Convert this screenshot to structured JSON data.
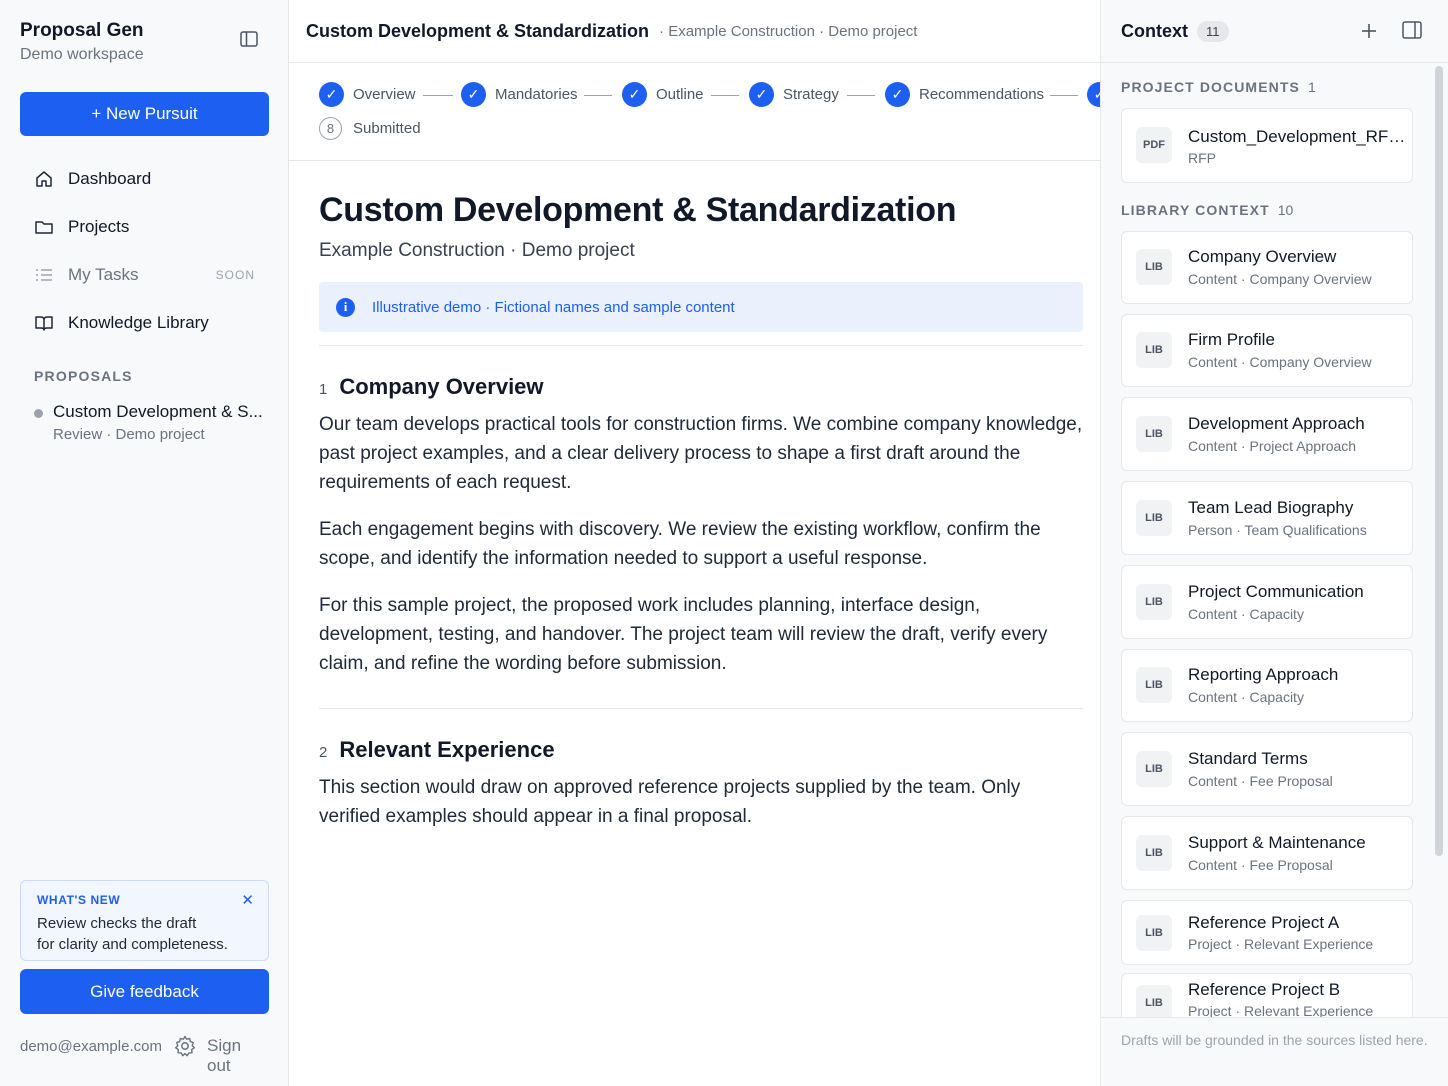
{
  "sidebar": {
    "brand_title": "Proposal Gen",
    "brand_sub": "Demo workspace",
    "new_button": "+ New Pursuit",
    "nav": [
      {
        "label": "Dashboard",
        "icon": "home-icon"
      },
      {
        "label": "Projects",
        "icon": "folder-icon"
      },
      {
        "label": "My Tasks",
        "icon": "list-icon",
        "tag": "SOON"
      },
      {
        "label": "Knowledge Library",
        "icon": "book-icon"
      }
    ],
    "proposals_label": "PROPOSALS",
    "proposal": {
      "title": "Custom Development & S...",
      "sub": "Review · Demo project"
    },
    "whats_new": {
      "label": "WHAT'S NEW",
      "line1": "Review checks the draft",
      "line2": "for clarity and completeness.",
      "close": "✕"
    },
    "feedback_button": "Give feedback",
    "email": "demo@example.com",
    "sign_out": "Sign out"
  },
  "topbar": {
    "title": "Custom Development & Standardization",
    "meta": "· Example Construction · Demo project"
  },
  "stepper": {
    "steps": [
      {
        "label": "Overview",
        "state": "done"
      },
      {
        "label": "Mandatories",
        "state": "done"
      },
      {
        "label": "Outline",
        "state": "done"
      },
      {
        "label": "Strategy",
        "state": "done"
      },
      {
        "label": "Recommendations",
        "state": "done"
      },
      {
        "label": "",
        "state": "done"
      },
      {
        "label": "Submitted",
        "state": "pending",
        "number": "8"
      }
    ]
  },
  "document": {
    "title": "Custom Development & Standardization",
    "subtitle": "Example Construction · Demo project",
    "banner": "Illustrative demo · Fictional names and sample content",
    "sections": [
      {
        "number": "1",
        "title": "Company Overview",
        "paragraphs": [
          "Our team develops practical tools for construction firms. We combine company knowledge, past project examples, and a clear delivery process to shape a first draft around the requirements of each request.",
          "Each engagement begins with discovery. We review the existing workflow, confirm the scope, and identify the information needed to support a useful response.",
          "For this sample project, the proposed work includes planning, interface design, development, testing, and handover. The project team will review the draft, verify every claim, and refine the wording before submission."
        ]
      },
      {
        "number": "2",
        "title": "Relevant Experience",
        "paragraphs": [
          "This section would draw on approved reference projects supplied by the team. Only verified examples should appear in a final proposal."
        ]
      }
    ]
  },
  "context": {
    "title": "Context",
    "count": "11",
    "docs_label": "PROJECT DOCUMENTS",
    "docs_count": "1",
    "docs": [
      {
        "badge": "PDF",
        "name": "Custom_Development_RFP...",
        "meta": "RFP"
      }
    ],
    "lib_label": "LIBRARY CONTEXT",
    "lib_count": "10",
    "library": [
      {
        "badge": "LIB",
        "name": "Company Overview",
        "meta": "Content · Company Overview"
      },
      {
        "badge": "LIB",
        "name": "Firm Profile",
        "meta": "Content · Company Overview"
      },
      {
        "badge": "LIB",
        "name": "Development Approach",
        "meta": "Content · Project Approach"
      },
      {
        "badge": "LIB",
        "name": "Team Lead Biography",
        "meta": "Person · Team Qualifications"
      },
      {
        "badge": "LIB",
        "name": "Project Communication",
        "meta": "Content · Capacity"
      },
      {
        "badge": "LIB",
        "name": "Reporting Approach",
        "meta": "Content · Capacity"
      },
      {
        "badge": "LIB",
        "name": "Standard Terms",
        "meta": "Content · Fee Proposal"
      },
      {
        "badge": "LIB",
        "name": "Support & Maintenance",
        "meta": "Content · Fee Proposal"
      },
      {
        "badge": "LIB",
        "name": "Reference Project A",
        "meta": "Project · Relevant Experience"
      },
      {
        "badge": "LIB",
        "name": "Reference Project B",
        "meta": "Project · Relevant Experience"
      }
    ],
    "footer": "Drafts will be grounded in the sources listed here."
  },
  "colors": {
    "accent": "#1d5ff0",
    "sidebar_bg": "#f8f9fb",
    "banner_bg": "#eaf1fd"
  }
}
